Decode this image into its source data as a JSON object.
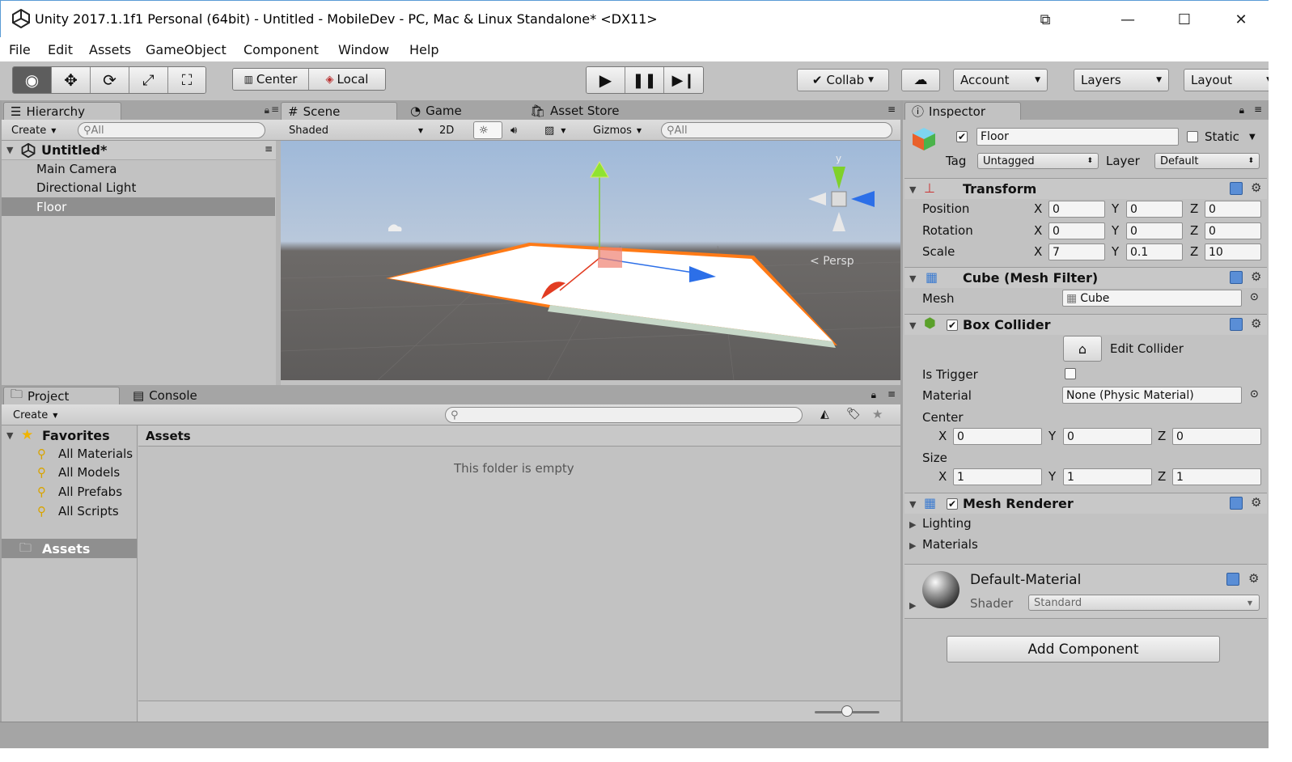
{
  "window": {
    "title": "Unity 2017.1.1f1 Personal (64bit) - Untitled - MobileDev - PC, Mac & Linux Standalone* <DX11>"
  },
  "menu": [
    "File",
    "Edit",
    "Assets",
    "GameObject",
    "Component",
    "Window",
    "Help"
  ],
  "toolbar": {
    "center_label": "Center",
    "local_label": "Local",
    "collab_label": "Collab",
    "account_label": "Account",
    "layers_label": "Layers",
    "layout_label": "Layout"
  },
  "hierarchy": {
    "tab": "Hierarchy",
    "create_label": "Create",
    "search_placeholder": "All",
    "scene_name": "Untitled*",
    "items": [
      "Main Camera",
      "Directional Light",
      "Floor"
    ],
    "selected_index": 2
  },
  "scene": {
    "tabs": [
      "Scene",
      "Game",
      "Asset Store"
    ],
    "draw_mode": "Shaded",
    "mode_2d": "2D",
    "gizmos_label": "Gizmos",
    "search_placeholder": "All",
    "gizmo_axis_label": "y",
    "persp_label": "Persp"
  },
  "project": {
    "tabs": [
      "Project",
      "Console"
    ],
    "create_label": "Create",
    "favorites_label": "Favorites",
    "favorites": [
      "All Materials",
      "All Models",
      "All Prefabs",
      "All Scripts"
    ],
    "assets_root": "Assets",
    "breadcrumb": "Assets",
    "empty_message": "This folder is empty",
    "slider_value": 0.5
  },
  "inspector": {
    "tab": "Inspector",
    "object_name": "Floor",
    "active": true,
    "static_label": "Static",
    "static": false,
    "tag_label": "Tag",
    "tag_value": "Untagged",
    "layer_label": "Layer",
    "layer_value": "Default",
    "transform": {
      "title": "Transform",
      "position_label": "Position",
      "rotation_label": "Rotation",
      "scale_label": "Scale",
      "position": [
        "0",
        "0",
        "0"
      ],
      "rotation": [
        "0",
        "0",
        "0"
      ],
      "scale": [
        "7",
        "0.1",
        "10"
      ]
    },
    "axes": [
      "X",
      "Y",
      "Z"
    ],
    "mesh_filter": {
      "title": "Cube (Mesh Filter)",
      "mesh_label": "Mesh",
      "mesh_value": "Cube"
    },
    "box_collider": {
      "title": "Box Collider",
      "enabled": true,
      "edit_label": "Edit Collider",
      "is_trigger_label": "Is Trigger",
      "is_trigger": false,
      "material_label": "Material",
      "material_value": "None (Physic Material)",
      "center_label": "Center",
      "center": [
        "0",
        "0",
        "0"
      ],
      "size_label": "Size",
      "size": [
        "1",
        "1",
        "1"
      ]
    },
    "mesh_renderer": {
      "title": "Mesh Renderer",
      "enabled": true,
      "lighting_label": "Lighting",
      "materials_label": "Materials"
    },
    "material": {
      "name": "Default-Material",
      "shader_label": "Shader",
      "shader_value": "Standard"
    },
    "add_component_label": "Add Component"
  }
}
